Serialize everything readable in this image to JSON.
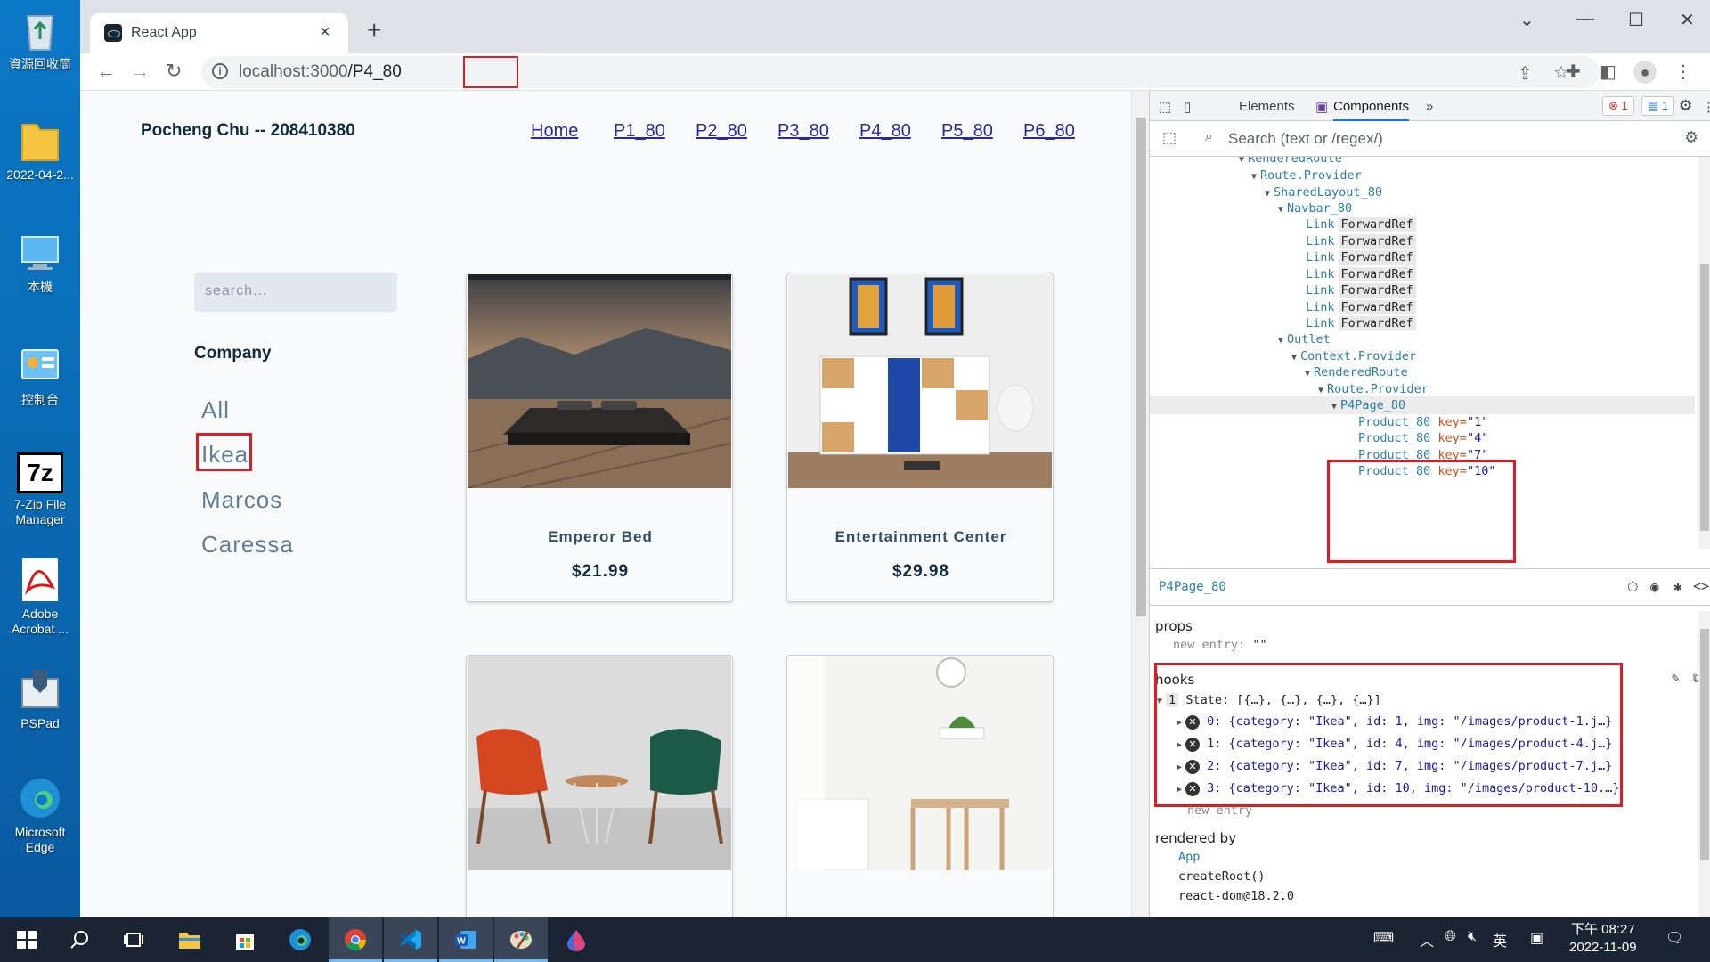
{
  "desktop": {
    "icons": [
      {
        "label": "資源回收筒",
        "icon": "recycle-bin-icon"
      },
      {
        "label": "2022-04-2...",
        "icon": "folder-icon"
      },
      {
        "label": "本機",
        "icon": "computer-icon"
      },
      {
        "label": "控制台",
        "icon": "control-panel-icon"
      },
      {
        "label": "7-Zip File Manager",
        "icon": "7zip-icon"
      },
      {
        "label": "Adobe Acrobat ...",
        "icon": "acrobat-icon"
      },
      {
        "label": "PSPad",
        "icon": "pspad-icon"
      },
      {
        "label": "Microsoft Edge",
        "icon": "edge-icon"
      }
    ],
    "sevenzip_logo": "7z"
  },
  "browser": {
    "tab_title": "React App",
    "url_host": "localhost:3000",
    "url_path": "/P4_80"
  },
  "page": {
    "brand": "Pocheng Chu -- 208410380",
    "nav": [
      "Home",
      "P1_80",
      "P2_80",
      "P3_80",
      "P4_80",
      "P5_80",
      "P6_80"
    ],
    "search_placeholder": "search...",
    "company_heading": "Company",
    "categories": [
      "All",
      "Ikea",
      "Marcos",
      "Caressa"
    ],
    "products": [
      {
        "name": "Emperor Bed",
        "price": "$21.99"
      },
      {
        "name": "Entertainment Center",
        "price": "$29.98"
      },
      {
        "name": "",
        "price": ""
      },
      {
        "name": "",
        "price": ""
      }
    ]
  },
  "devtools": {
    "tabs": [
      "Elements",
      "Components"
    ],
    "error_count": "1",
    "message_count": "1",
    "search_placeholder": "Search (text or /regex/)",
    "tree": [
      {
        "label": "RenderedRoute"
      },
      {
        "label": "Route.Provider"
      },
      {
        "label": "SharedLayout_80"
      },
      {
        "label": "Navbar_80"
      },
      {
        "label": "Link",
        "tag": "ForwardRef"
      },
      {
        "label": "Link",
        "tag": "ForwardRef"
      },
      {
        "label": "Link",
        "tag": "ForwardRef"
      },
      {
        "label": "Link",
        "tag": "ForwardRef"
      },
      {
        "label": "Link",
        "tag": "ForwardRef"
      },
      {
        "label": "Link",
        "tag": "ForwardRef"
      },
      {
        "label": "Link",
        "tag": "ForwardRef"
      },
      {
        "label": "Outlet"
      },
      {
        "label": "Context.Provider"
      },
      {
        "label": "RenderedRoute"
      },
      {
        "label": "Route.Provider"
      },
      {
        "label": "P4Page_80"
      },
      {
        "label": "Product_80",
        "key": "\"1\""
      },
      {
        "label": "Product_80",
        "key": "\"4\""
      },
      {
        "label": "Product_80",
        "key": "\"7\""
      },
      {
        "label": "Product_80",
        "key": "\"10\""
      }
    ],
    "key_label": "key=",
    "selected_component": "P4Page_80",
    "props_heading": "props",
    "props_new_entry": "new entry:",
    "props_new_entry_value": "\"\"",
    "hooks_heading": "hooks",
    "state_index": "1",
    "state_label": "State: [{…}, {…}, {…}, {…}]",
    "state_items": [
      "0: {category: \"Ikea\", id: 1, img: \"/images/product-1.j…}",
      "1: {category: \"Ikea\", id: 4, img: \"/images/product-4.j…}",
      "2: {category: \"Ikea\", id: 7, img: \"/images/product-7.j…}",
      "3: {category: \"Ikea\", id: 10, img: \"/images/product-10.…}"
    ],
    "hooks_new_entry": "new entry",
    "rendered_by_heading": "rendered by",
    "rendered_by": [
      "App",
      "createRoot()",
      "react-dom@18.2.0"
    ]
  },
  "taskbar": {
    "word_letter": "W",
    "ime": "英",
    "time": "下午 08:27",
    "date": "2022-11-09"
  },
  "colors": {
    "highlight_red": "#e01b24",
    "devtools_component_blue": "#2a7fa6",
    "page_bg": "#f8fafc"
  }
}
